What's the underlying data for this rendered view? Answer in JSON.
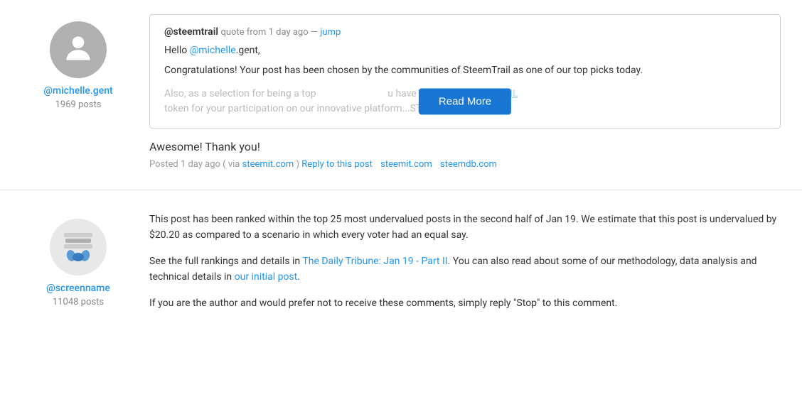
{
  "first_comment": {
    "author": {
      "name": "@michelle.gent",
      "posts": "1969 posts"
    },
    "quote": {
      "author": "@steemtrail",
      "meta": "quote from 1 day ago —",
      "jump_label": "jump",
      "greeting": "Hello ",
      "greeting_mention": "@michelle",
      "greeting_suffix": ".gent,",
      "main_text": "Congratulations! Your post has been chosen by the communities of SteemTrail as one of our top picks today.",
      "faded_prefix": "Also, as a selection for being a top",
      "faded_suffix": "u have been",
      "faded_link": "awarded a TRAIL",
      "faded_end": "token for your participation on our innovative platform...STEEM. Please visit",
      "read_more_label": "Read More"
    },
    "reply_text": "Awesome! Thank you!",
    "posted": "Posted 1 day ago ( via ",
    "via_link": "steemit.com",
    "reply_label": "Reply to this post",
    "link1": "steemit.com",
    "link2": "steemdb.com"
  },
  "second_comment": {
    "author": {
      "name": "@screenname",
      "posts": "11048 posts"
    },
    "paragraphs": [
      "This post has been ranked within the top 25 most undervalued posts in the second half of Jan 19. We estimate that this post is undervalued by $20.20 as compared to a scenario in which every voter had an equal say.",
      "See the full rankings and details in The Daily Tribune: Jan 19 - Part II. You can also read about some of our methodology, data analysis and technical details in our initial post.",
      "If you are the author and would prefer not to receive these comments, simply reply \"Stop\" to this comment."
    ],
    "tribune_link": "The Daily Tribune: Jan 19 - Part II",
    "initial_post_link": "our initial post"
  }
}
